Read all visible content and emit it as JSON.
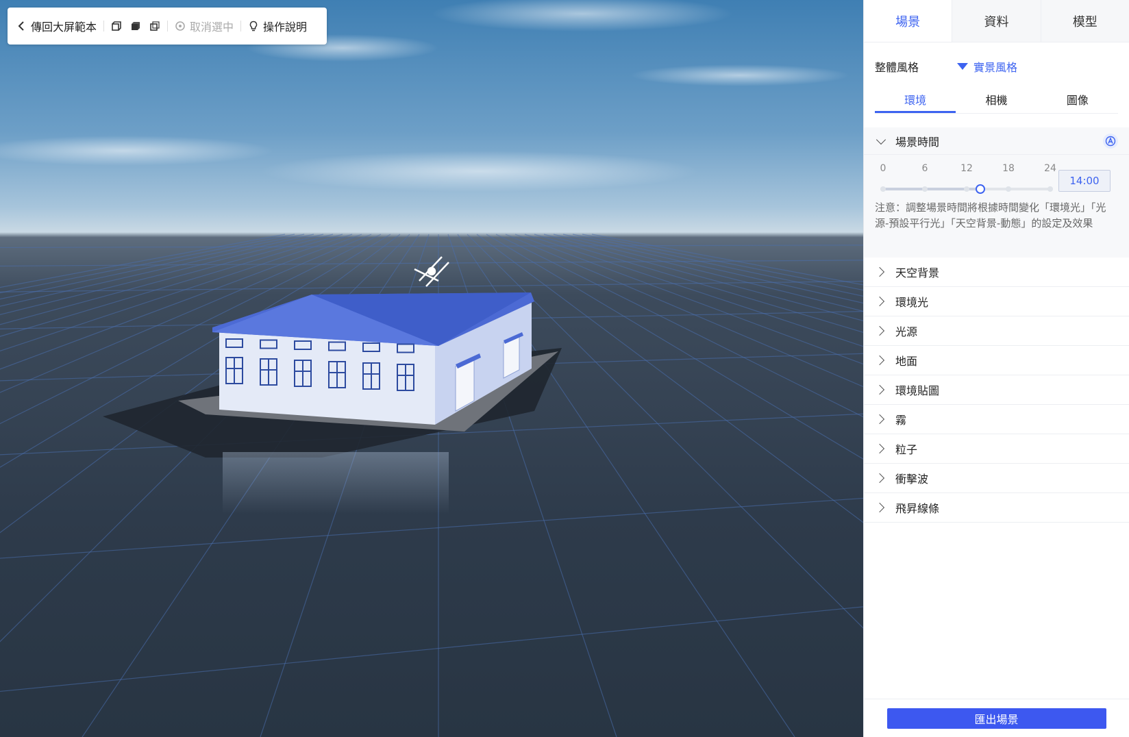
{
  "toolbar": {
    "back_label": "傳回大屏範本",
    "deselect_label": "取消選中",
    "help_label": "操作說明"
  },
  "panel": {
    "top_tabs": [
      "場景",
      "資料",
      "模型"
    ],
    "active_top_tab": "場景",
    "style_label": "整體風格",
    "style_value": "實景風格",
    "sub_tabs": [
      "環境",
      "相機",
      "圖像"
    ],
    "active_sub_tab": "環境",
    "time_section": {
      "title": "場景時間",
      "ticks": [
        "0",
        "6",
        "12",
        "18",
        "24"
      ],
      "hour": 14,
      "value_label": "14:00",
      "note": "注意：調整場景時間將根據時間變化「環境光」「光源-預設平行光」「天空背景-動態」的設定及效果"
    },
    "accordion": [
      "天空背景",
      "環境光",
      "光源",
      "地面",
      "環境貼圖",
      "霧",
      "粒子",
      "衝擊波",
      "飛昇線條"
    ],
    "export_label": "匯出場景"
  },
  "colors": {
    "accent": "#3d63f0",
    "roof": "#4f6fd6",
    "wall": "#dfe6f6"
  }
}
